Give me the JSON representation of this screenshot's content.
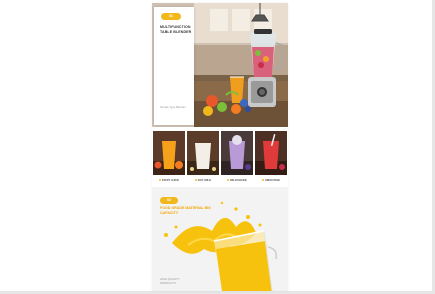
{
  "colors": {
    "accent": "#f2b81b",
    "juice": "#f6c20e",
    "title_dark": "#333333"
  },
  "hero": {
    "badge": "01",
    "title": "MULTIFUNCTION TABLE BLENDER",
    "footnote": "Simple Type Blender"
  },
  "drinks": [
    {
      "label": "FRUIT JUICE"
    },
    {
      "label": "SOY MILK"
    },
    {
      "label": "MILKSHAKE"
    },
    {
      "label": "SMOOTHIE"
    }
  ],
  "juice": {
    "badge": "02",
    "title": "FOOD GRADE MATERIAL BIG CAPACITY",
    "footnote": "HIGH QUALITY PRODUCTS"
  }
}
